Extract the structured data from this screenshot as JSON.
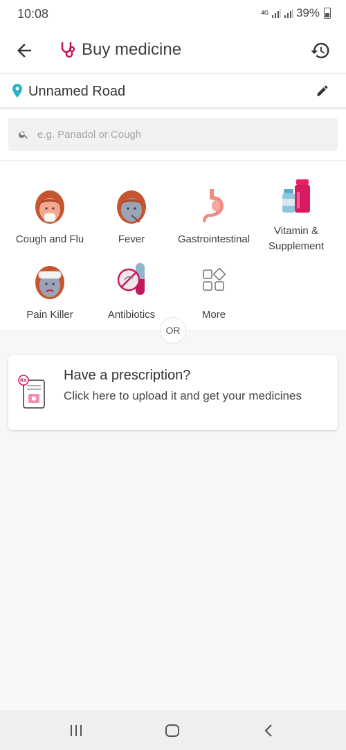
{
  "status_bar": {
    "time": "10:08",
    "network": "4G",
    "battery": "39%"
  },
  "header": {
    "title": "Buy medicine",
    "icons": {
      "back": "arrow-left",
      "logo": "stethoscope",
      "history": "history-clock"
    }
  },
  "location": {
    "text": "Unnamed Road",
    "icons": {
      "pin": "location-pin",
      "edit": "pencil"
    }
  },
  "search": {
    "placeholder": "e.g. Panadol or Cough",
    "value": ""
  },
  "categories": [
    {
      "label": "Cough and Flu",
      "icon": "cough-face"
    },
    {
      "label": "Fever",
      "icon": "fever-face"
    },
    {
      "label": "Gastrointestinal",
      "icon": "stomach"
    },
    {
      "label": "Vitamin & Supplement",
      "icon": "vitamin-bottles"
    },
    {
      "label": "Pain Killer",
      "icon": "bandaged-face"
    },
    {
      "label": "Antibiotics",
      "icon": "antibiotics-capsule"
    },
    {
      "label": "More",
      "icon": "grid-more"
    }
  ],
  "divider": {
    "or_label": "OR"
  },
  "prescription": {
    "title": "Have a prescription?",
    "subtitle": "Click here to upload it and get your medicines",
    "icon": "rx-document",
    "icon_text": "RX"
  },
  "nav_bar": {
    "icons": [
      "recent-apps",
      "home",
      "back"
    ]
  },
  "colors": {
    "accent": "#c2185b",
    "pin": "#26b5c8",
    "background": "#f7f7f7"
  }
}
